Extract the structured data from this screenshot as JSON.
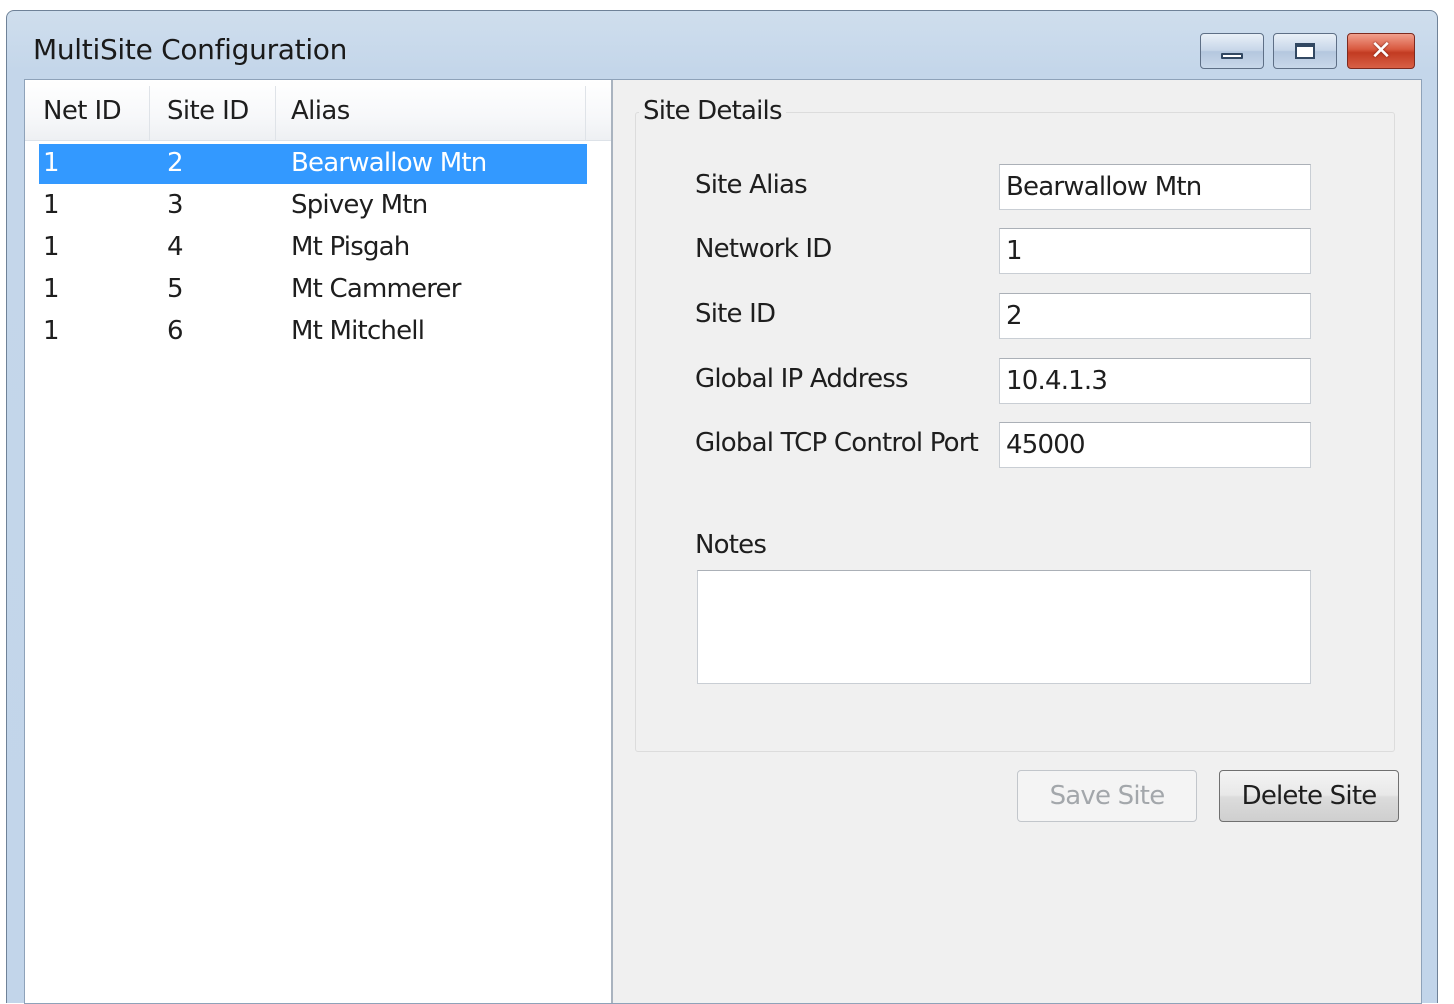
{
  "window": {
    "title": "MultiSite Configuration"
  },
  "title_bar": {
    "minimize_icon": "minimize-icon",
    "maximize_icon": "maximize-icon",
    "close_icon": "close-icon",
    "close_color": "#c23b22"
  },
  "site_list": {
    "columns": [
      "Net ID",
      "Site ID",
      "Alias"
    ],
    "selection_color": "#3399ff",
    "rows": [
      {
        "net_id": "1",
        "site_id": "2",
        "alias": "Bearwallow Mtn",
        "selected": true
      },
      {
        "net_id": "1",
        "site_id": "3",
        "alias": "Spivey Mtn",
        "selected": false
      },
      {
        "net_id": "1",
        "site_id": "4",
        "alias": "Mt Pisgah",
        "selected": false
      },
      {
        "net_id": "1",
        "site_id": "5",
        "alias": "Mt Cammerer",
        "selected": false
      },
      {
        "net_id": "1",
        "site_id": "6",
        "alias": "Mt Mitchell",
        "selected": false
      }
    ]
  },
  "site_details": {
    "group_label": "Site Details",
    "fields": [
      {
        "label": "Site Alias",
        "value": "Bearwallow Mtn"
      },
      {
        "label": "Network ID",
        "value": "1"
      },
      {
        "label": "Site ID",
        "value": "2"
      },
      {
        "label": "Global IP Address",
        "value": "10.4.1.3"
      },
      {
        "label": "Global TCP Control Port",
        "value": "45000"
      }
    ],
    "notes_label": "Notes",
    "notes_value": ""
  },
  "buttons": {
    "save_label": "Save Site",
    "save_enabled": false,
    "delete_label": "Delete Site"
  }
}
